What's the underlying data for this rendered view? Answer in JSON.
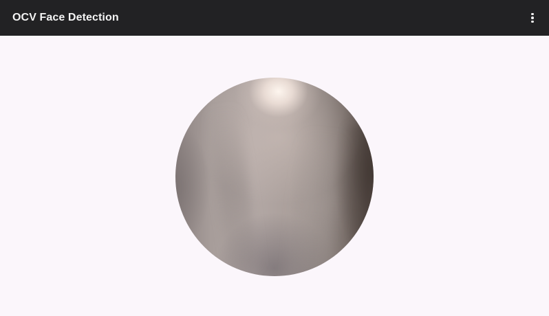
{
  "app_bar": {
    "title": "OCV Face Detection",
    "background_color": "#222224",
    "title_color": "#f4f4f4",
    "menu_icon": "more-vert-icon"
  },
  "content": {
    "background_color": "#fbf6fb",
    "preview": {
      "shape": "circle",
      "description_icon": "camera-preview-image"
    }
  }
}
